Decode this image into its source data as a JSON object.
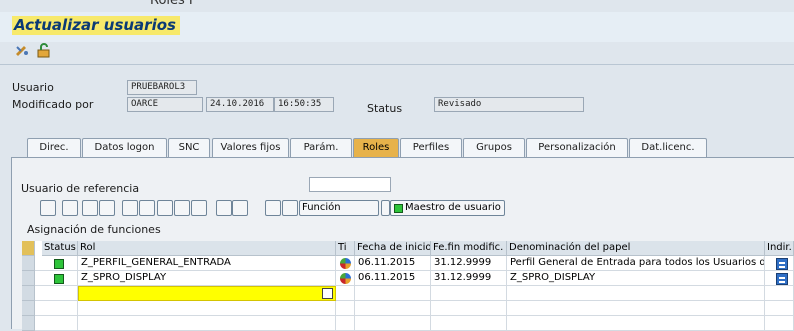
{
  "header": {
    "cut_text": "Roles I",
    "title": "Actualizar usuarios"
  },
  "user_info": {
    "usuario_label": "Usuario",
    "usuario_value": "PRUEBAROL3",
    "modificado_label": "Modificado por",
    "modificado_value": "OARCE",
    "date_value": "24.10.2016",
    "time_value": "16:50:35",
    "status_label": "Status",
    "status_value": "Revisado"
  },
  "tabs": [
    "Direc.",
    "Datos logon",
    "SNC",
    "Valores fijos",
    "Parám.",
    "Roles",
    "Perfiles",
    "Grupos",
    "Personalización",
    "Dat.licenc."
  ],
  "active_tab": "Roles",
  "roles_panel": {
    "ref_label": "Usuario de referencia",
    "ref_value": "",
    "funcion_button": "Función",
    "maestro_button": "Maestro de usuario",
    "section_label": "Asignación de funciones"
  },
  "table": {
    "headers": [
      "Status",
      "Rol",
      "Ti",
      "Fecha de inicio",
      "Fe.fin modific.",
      "Denominación del papel",
      "Indir."
    ],
    "rows": [
      {
        "rol": "Z_PERFIL_GENERAL_ENTRADA",
        "start": "06.11.2015",
        "end": "31.12.9999",
        "desc": "Perfil General de Entrada para todos los Usuarios d..."
      },
      {
        "rol": "Z_SPRO_DISPLAY",
        "start": "06.11.2015",
        "end": "31.12.9999",
        "desc": "Z_SPRO_DISPLAY"
      }
    ]
  },
  "colors": {
    "title_highlight": "#f7e96b",
    "active_tab": "#e7b24a",
    "status_green": "#2ec43a",
    "input_highlight": "#ffff00"
  }
}
